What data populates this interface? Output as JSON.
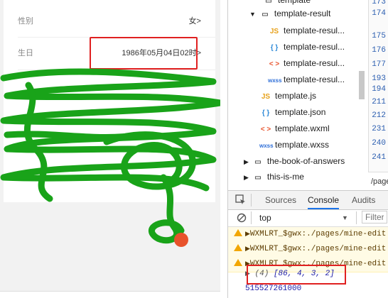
{
  "phone": {
    "rows": [
      {
        "label": "性别",
        "value": "女>"
      },
      {
        "label": "生日",
        "value": "1986年05月04日02时>"
      }
    ],
    "colors": {
      "highlight": "#e02020",
      "scribble": "#19a319"
    }
  },
  "file_tree": {
    "folder_top": "template",
    "folder_open": "template-result",
    "children": [
      {
        "icon": "js-file-icon",
        "glyph": "JS",
        "name": "template-resul..."
      },
      {
        "icon": "json-file-icon",
        "glyph": "{ }",
        "name": "template-resul..."
      },
      {
        "icon": "wxml-file-icon",
        "glyph": "< >",
        "name": "template-resul..."
      },
      {
        "icon": "wxss-file-icon",
        "glyph": "wxss",
        "name": "template-resul..."
      }
    ],
    "files": [
      {
        "icon": "js-file-icon",
        "glyph": "JS",
        "name": "template.js"
      },
      {
        "icon": "json-file-icon",
        "glyph": "{ }",
        "name": "template.json"
      },
      {
        "icon": "wxml-file-icon",
        "glyph": "< >",
        "name": "template.wxml"
      },
      {
        "icon": "wxss-file-icon",
        "glyph": "wxss",
        "name": "template.wxss"
      }
    ],
    "folders": [
      "the-book-of-answers",
      "this-is-me"
    ]
  },
  "editor": {
    "line_numbers": [
      "173",
      "174",
      "175",
      "176",
      "177",
      "193",
      "194",
      "211",
      "212",
      "231",
      "240",
      "241"
    ],
    "path_label": "/page"
  },
  "devtools": {
    "tabs": [
      "Sources",
      "Console",
      "Audits"
    ],
    "active_tab": "Console",
    "context": "top",
    "filter_placeholder": "Filter"
  },
  "console": {
    "warnings": [
      "WXMLRT_$gwx:./pages/mine-edit",
      "WXMLRT_$gwx:./pages/mine-edit",
      "WXMLRT_$gwx:./pages/mine-edit"
    ],
    "array_count": "(4)",
    "array_value": "[86, 4, 3, 2]",
    "number_output": "515527261000"
  }
}
